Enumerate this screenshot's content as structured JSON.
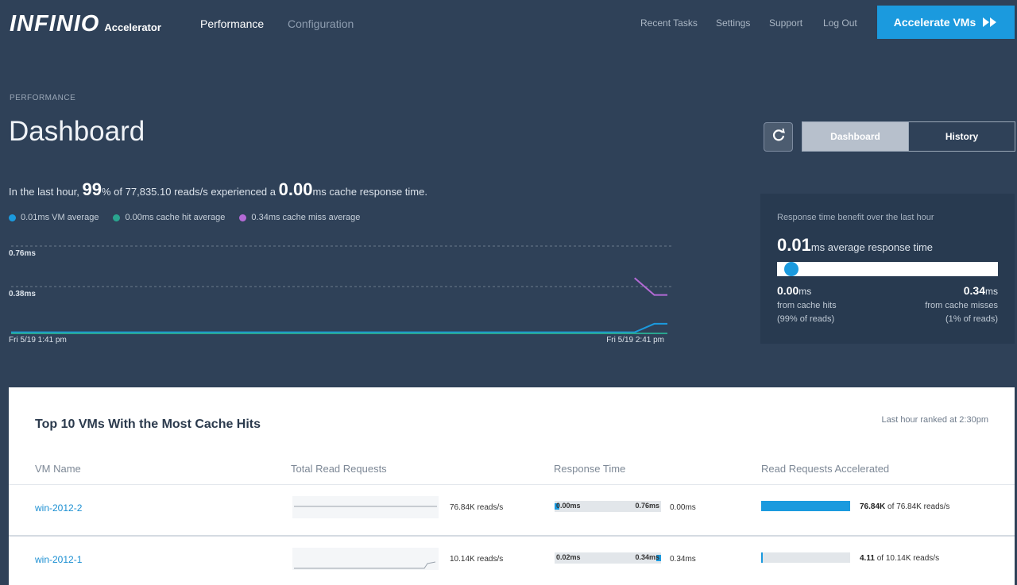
{
  "brand": {
    "name": "INFINIO",
    "product": "Accelerator"
  },
  "nav": {
    "primary": [
      {
        "label": "Performance",
        "active": true
      },
      {
        "label": "Configuration",
        "active": false
      }
    ],
    "utility": [
      "Recent Tasks",
      "Settings",
      "Support",
      "Log Out"
    ],
    "cta_label": "Accelerate VMs"
  },
  "page": {
    "breadcrumb": "PERFORMANCE",
    "title": "Dashboard",
    "view_toggle": {
      "options": [
        "Dashboard",
        "History"
      ],
      "selected": "Dashboard"
    }
  },
  "summary": {
    "prefix": "In the last hour,",
    "percent": "99",
    "mid": "% of 77,835.10 reads/s experienced a",
    "response": "0.00",
    "suffix": "ms cache response time."
  },
  "legend": [
    {
      "label": "0.01ms VM average",
      "color": "#1b9ade"
    },
    {
      "label": "0.00ms cache hit average",
      "color": "#2aa58f"
    },
    {
      "label": "0.34ms cache miss average",
      "color": "#b46ad6"
    }
  ],
  "chart_data": {
    "type": "line",
    "y_ticks": [
      "0.76ms",
      "0.38ms"
    ],
    "ylim": [
      0,
      0.76
    ],
    "x_labels": [
      "Fri 5/19 1:41 pm",
      "Fri 5/19 2:41 pm"
    ],
    "grid": true,
    "series": [
      {
        "name": "VM average",
        "color": "#1b9ade",
        "x": [
          0,
          0.95,
          0.98,
          1.0
        ],
        "y": [
          0.01,
          0.01,
          0.09,
          0.09
        ]
      },
      {
        "name": "cache hit average",
        "color": "#2aa58f",
        "x": [
          0,
          0.95,
          1.0
        ],
        "y": [
          0.0,
          0.0,
          0.0
        ]
      },
      {
        "name": "cache miss average",
        "color": "#b46ad6",
        "x": [
          0.95,
          0.98,
          1.0
        ],
        "y": [
          0.52,
          0.36,
          0.36
        ]
      }
    ]
  },
  "benefit": {
    "title": "Response time benefit over the last hour",
    "value": "0.01",
    "value_suffix": "ms average response time",
    "position": 0.03,
    "left": {
      "value": "0.00",
      "unit": "ms",
      "label": "from cache hits",
      "share": "(99% of reads)"
    },
    "right": {
      "value": "0.34",
      "unit": "ms",
      "label": "from cache misses",
      "share": "(1% of reads)"
    }
  },
  "table": {
    "title": "Top 10 VMs With the Most Cache Hits",
    "meta": "Last hour ranked at 2:30pm",
    "columns": [
      "VM Name",
      "Total Read Requests",
      "Response Time",
      "Read Requests Accelerated"
    ],
    "rows": [
      {
        "vm": "win-2012-2",
        "reads": "76.84K reads/s",
        "resp_min": "0.00ms",
        "resp_max": "0.76ms",
        "resp_value": "0.00ms",
        "resp_position": 0.0,
        "accel_value": "76.84K",
        "accel_of": "of 76.84K reads/s",
        "accel_fraction": 1.0
      },
      {
        "vm": "win-2012-1",
        "reads": "10.14K reads/s",
        "resp_min": "0.02ms",
        "resp_max": "0.34ms",
        "resp_value": "0.34ms",
        "resp_position": 1.0,
        "accel_value": "4.11",
        "accel_of": "of 10.14K reads/s",
        "accel_fraction": 0.0004
      }
    ]
  }
}
